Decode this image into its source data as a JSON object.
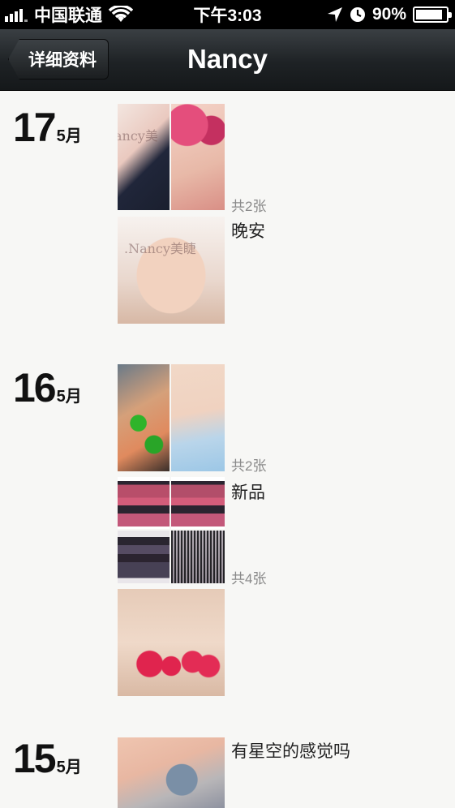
{
  "status_bar": {
    "carrier": "中国联通",
    "time": "下午3:03",
    "battery_percent": "90%",
    "battery_level": 0.9,
    "icons": [
      "signal-icon",
      "wifi-icon",
      "location-icon",
      "clock-icon",
      "battery-icon"
    ]
  },
  "nav": {
    "back_label": "详细资料",
    "title": "Nancy"
  },
  "timeline": [
    {
      "day": "17",
      "month": "5月",
      "posts": [
        {
          "count": "共2张",
          "caption": "晚安",
          "photos": [
            "nail-photo",
            "nail-photo",
            "nail-photo"
          ],
          "watermark": ".Nancy美睫"
        }
      ]
    },
    {
      "day": "16",
      "month": "5月",
      "posts": [
        {
          "count": "共2张",
          "caption": "新品",
          "photos": [
            "nail-photo",
            "nail-photo"
          ]
        },
        {
          "count": "共4张",
          "caption": "",
          "photos": [
            "lash-photo",
            "lash-photo",
            "lash-photo",
            "lash-photo"
          ]
        },
        {
          "count": "",
          "caption": "",
          "photos": [
            "nail-photo"
          ]
        }
      ]
    },
    {
      "day": "15",
      "month": "5月",
      "posts": [
        {
          "count": "",
          "caption": "有星空的感觉吗",
          "photos": [
            "nail-photo"
          ]
        }
      ]
    }
  ]
}
